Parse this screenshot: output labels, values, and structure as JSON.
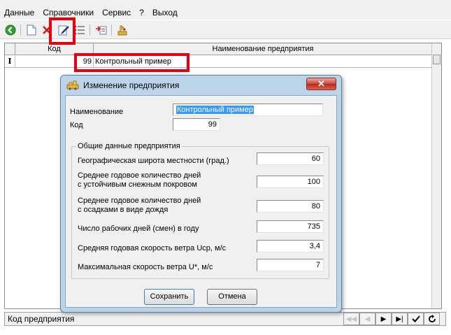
{
  "menu": {
    "items": [
      "Данные",
      "Справочники",
      "Сервис",
      "?",
      "Выход"
    ]
  },
  "toolbar": {
    "icons": [
      "back-icon",
      "new-document-icon",
      "delete-icon",
      "edit-icon",
      "list-icon",
      "export-icon",
      "hand-icon"
    ]
  },
  "grid": {
    "columns": [
      "Код",
      "Наименование предприятия"
    ],
    "row_marker": "I",
    "rows": [
      {
        "code": "99",
        "name": "Контрольный пример"
      }
    ]
  },
  "statusbar": {
    "text": "Код предприятия"
  },
  "dialog": {
    "title": "Изменение предприятия",
    "name_label": "Наименование",
    "name_value": "Контрольный пример",
    "code_label": "Код",
    "code_value": "99",
    "group_title": "Общие данные предприятия",
    "fields": [
      {
        "label1": "Географическая широта местности (град.)",
        "label2": "",
        "value": "60"
      },
      {
        "label1": "Среднее годовое количество дней",
        "label2": "с устойчивым снежным покровом",
        "value": "100"
      },
      {
        "label1": "Среднее годовое количество дней",
        "label2": "с осадками в виде дождя",
        "value": "80"
      },
      {
        "label1": "Число рабочих дней (смен) в году",
        "label2": "",
        "value": "735"
      },
      {
        "label1": "Средняя годовая скорость ветра Uср, м/с",
        "label2": "",
        "value": "3,4"
      },
      {
        "label1": "Максимальная скорость ветра U*, м/с",
        "label2": "",
        "value": "7"
      }
    ],
    "save_label": "Сохранить",
    "cancel_label": "Отмена",
    "close_glyph": "✕"
  },
  "colors": {
    "highlight": "#e8000f",
    "dialog_frame": "#bcd4ea",
    "selection": "#3399ff"
  }
}
